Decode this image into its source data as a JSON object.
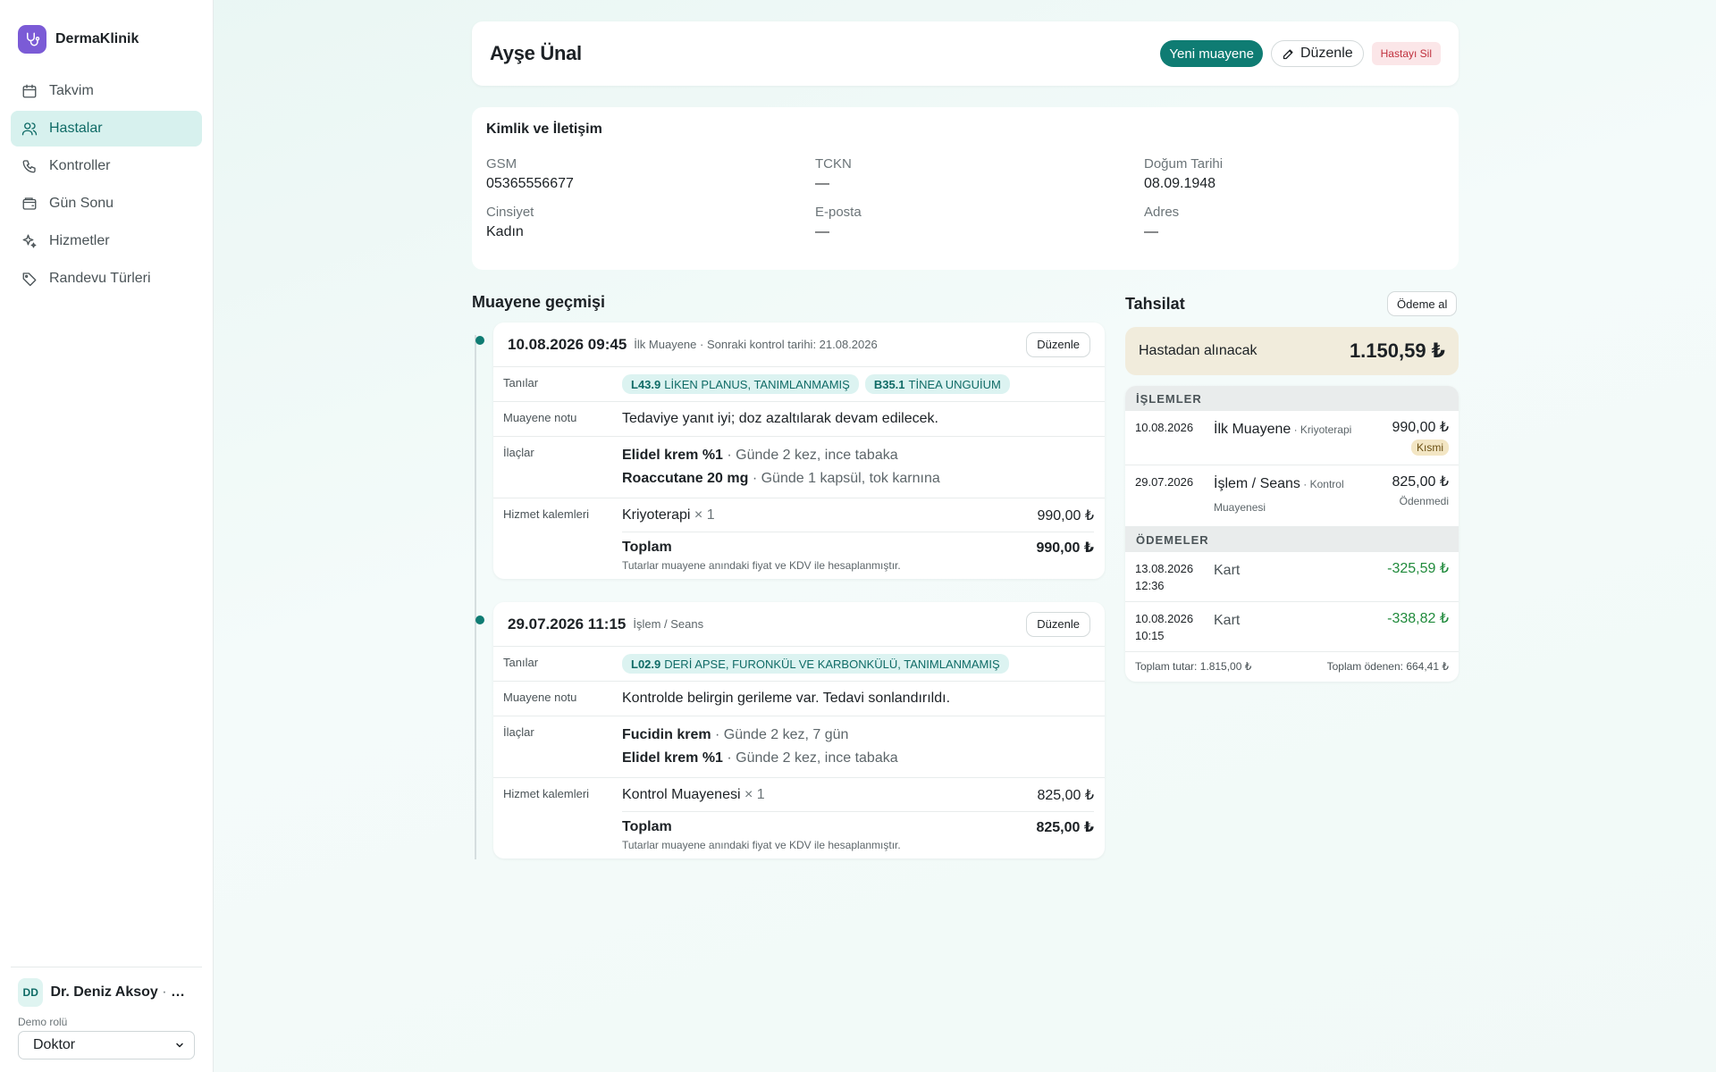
{
  "brand": {
    "name": "DermaKlinik",
    "icon": "stethoscope-icon"
  },
  "nav": [
    {
      "label": "Takvim",
      "icon": "calendar-icon",
      "active": false
    },
    {
      "label": "Hastalar",
      "icon": "users-icon",
      "active": true
    },
    {
      "label": "Kontroller",
      "icon": "phone-icon",
      "active": false
    },
    {
      "label": "Gün Sonu",
      "icon": "wallet-icon",
      "active": false
    },
    {
      "label": "Hizmetler",
      "icon": "sparkles-icon",
      "active": false
    },
    {
      "label": "Randevu Türleri",
      "icon": "tag-icon",
      "active": false
    }
  ],
  "user": {
    "initials": "DD",
    "name": "Dr. Deniz Aksoy",
    "role": " · Doktor",
    "demo_label": "Demo rolü",
    "selected_role": "Doktor"
  },
  "header": {
    "patient_name": "Ayşe Ünal",
    "new_exam": "Yeni muayene",
    "edit": "Düzenle",
    "delete": "Hastayı Sil"
  },
  "identity": {
    "title": "Kimlik ve İletişim",
    "fields": [
      {
        "label": "GSM",
        "value": "05365556677"
      },
      {
        "label": "TCKN",
        "value": "—"
      },
      {
        "label": "Doğum Tarihi",
        "value": "08.09.1948"
      },
      {
        "label": "Cinsiyet",
        "value": "Kadın"
      },
      {
        "label": "E-posta",
        "value": "—"
      },
      {
        "label": "Adres",
        "value": "—"
      }
    ]
  },
  "history": {
    "title": "Muayene geçmişi",
    "labels": {
      "diagnoses": "Tanılar",
      "note": "Muayene notu",
      "meds": "İlaçlar",
      "services": "Hizmet kalemleri",
      "total": "Toplam",
      "total_note": "Tutarlar muayene anındaki fiyat ve KDV ile hesaplanmıştır.",
      "edit": "Düzenle"
    },
    "exams": [
      {
        "datetime": "10.08.2026 09:45",
        "subtitle": "İlk Muayene · Sonraki kontrol tarihi: 21.08.2026",
        "diagnoses": [
          {
            "code": "L43.9",
            "name": "LİKEN PLANUS, TANIMLANMAMIŞ"
          },
          {
            "code": "B35.1",
            "name": "TİNEA UNGUİUM"
          }
        ],
        "note": "Tedaviye yanıt iyi; doz azaltılarak devam edilecek.",
        "meds": [
          {
            "name": "Elidel krem %1",
            "detail": " · Günde 2 kez, ince tabaka"
          },
          {
            "name": "Roaccutane 20 mg",
            "detail": " · Günde 1 kapsül, tok karnına"
          }
        ],
        "service": {
          "name": "Kriyoterapi",
          "qty": " × 1",
          "amount": "990,00 ₺"
        },
        "total": "990,00 ₺"
      },
      {
        "datetime": "29.07.2026 11:15",
        "subtitle": "İşlem / Seans",
        "diagnoses": [
          {
            "code": "L02.9",
            "name": "DERİ APSE, FURONKÜL VE KARBONKÜLÜ, TANIMLANMAMIŞ"
          }
        ],
        "note": "Kontrolde belirgin gerileme var. Tedavi sonlandırıldı.",
        "meds": [
          {
            "name": "Fucidin krem",
            "detail": " · Günde 2 kez, 7 gün"
          },
          {
            "name": "Elidel krem %1",
            "detail": " · Günde 2 kez, ince tabaka"
          }
        ],
        "service": {
          "name": "Kontrol Muayenesi",
          "qty": " × 1",
          "amount": "825,00 ₺"
        },
        "total": "825,00 ₺"
      }
    ]
  },
  "billing": {
    "title": "Tahsilat",
    "pay_button": "Ödeme al",
    "balance_label": "Hastadan alınacak",
    "balance_value": "1.150,59 ₺",
    "ops_title": "İŞLEMLER",
    "operations": [
      {
        "date": "10.08.2026",
        "name": "İlk Muayene",
        "detail": " · Kriyoterapi",
        "amount": "990,00 ₺",
        "status": "Kısmi"
      },
      {
        "date": "29.07.2026",
        "name": "İşlem / Seans",
        "detail": " · Kontrol Muayenesi",
        "amount": "825,00 ₺",
        "status": "Ödenmedi"
      }
    ],
    "payments_title": "ÖDEMELER",
    "payments": [
      {
        "date": "13.08.2026",
        "time": "12:36",
        "method": "Kart",
        "amount": "-325,59 ₺"
      },
      {
        "date": "10.08.2026",
        "time": "10:15",
        "method": "Kart",
        "amount": "-338,82 ₺"
      }
    ],
    "total_amount": "Toplam tutar: 1.815,00 ₺",
    "total_paid": "Toplam ödenen: 664,41 ₺"
  },
  "colors": {
    "accent": "#0f7c73",
    "brand": "#7b5bd6",
    "danger": "#c0313e",
    "positive": "#1f8a3b"
  }
}
